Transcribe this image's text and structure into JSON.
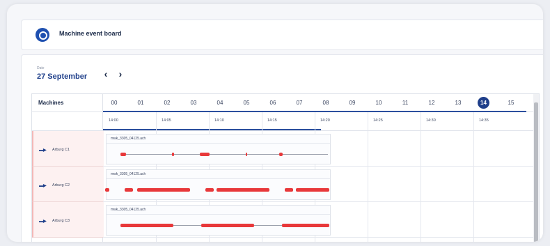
{
  "header": {
    "title": "Machine event board",
    "icon": "machine-icon"
  },
  "date": {
    "caption": "Date",
    "value": "27 September",
    "prev_label": "‹",
    "next_label": "›"
  },
  "grid": {
    "machines_header": "Machines",
    "hours": [
      "00",
      "01",
      "02",
      "03",
      "04",
      "05",
      "06",
      "07",
      "08",
      "09",
      "10",
      "11",
      "12",
      "13",
      "14",
      "15"
    ],
    "selected_hour": "14",
    "minutes": [
      "14:00",
      "14:05",
      "14:10",
      "14:15",
      "14:20",
      "14:25",
      "14:30",
      "14:35"
    ]
  },
  "machines": [
    {
      "name": "Arburg C1",
      "job": "mwk_3305_04125.ach"
    },
    {
      "name": "Arburg C2",
      "job": "mwk_3305_04125.ach"
    },
    {
      "name": "Arburg C3",
      "job": "mwk_3305_04125.ach"
    }
  ],
  "colors": {
    "accent": "#1f3f8a",
    "event": "#e8383a",
    "machine_bg": "#fdf1f1"
  }
}
